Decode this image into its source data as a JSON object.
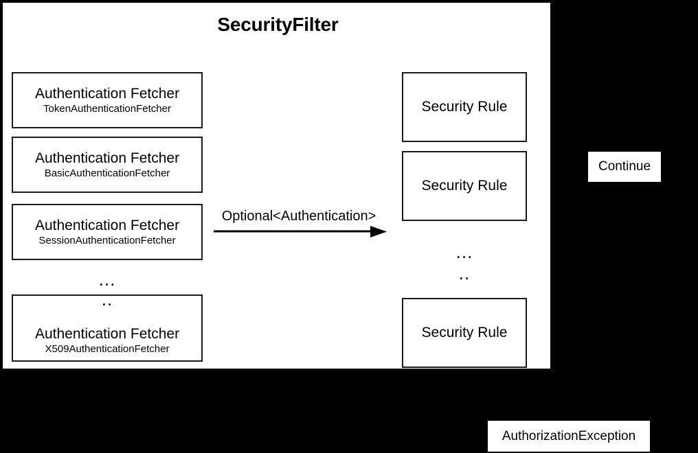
{
  "diagram": {
    "title": "SecurityFilter",
    "fetchers": [
      {
        "title": "Authentication Fetcher",
        "implementation": "TokenAuthenticationFetcher"
      },
      {
        "title": "Authentication Fetcher",
        "implementation": "BasicAuthenticationFetcher"
      },
      {
        "title": "Authentication Fetcher",
        "implementation": "SessionAuthenticationFetcher"
      },
      {
        "title": "Authentication Fetcher",
        "implementation": "X509AuthenticationFetcher"
      }
    ],
    "fetcher_ellipsis": {
      "major": "…",
      "minor": ".."
    },
    "arrow": {
      "label": "Optional<Authentication>"
    },
    "rules": [
      {
        "label": "Security Rule"
      },
      {
        "label": "Security Rule"
      },
      {
        "label": "Security Rule"
      }
    ],
    "rule_ellipsis": {
      "major": "…",
      "minor": ".."
    },
    "outcomes": {
      "success": "Continue",
      "failure": "AuthorizationException"
    },
    "colors": {
      "background": "#000000",
      "panel": "#ffffff",
      "stroke": "#1a1a1a",
      "text": "#000000"
    }
  }
}
